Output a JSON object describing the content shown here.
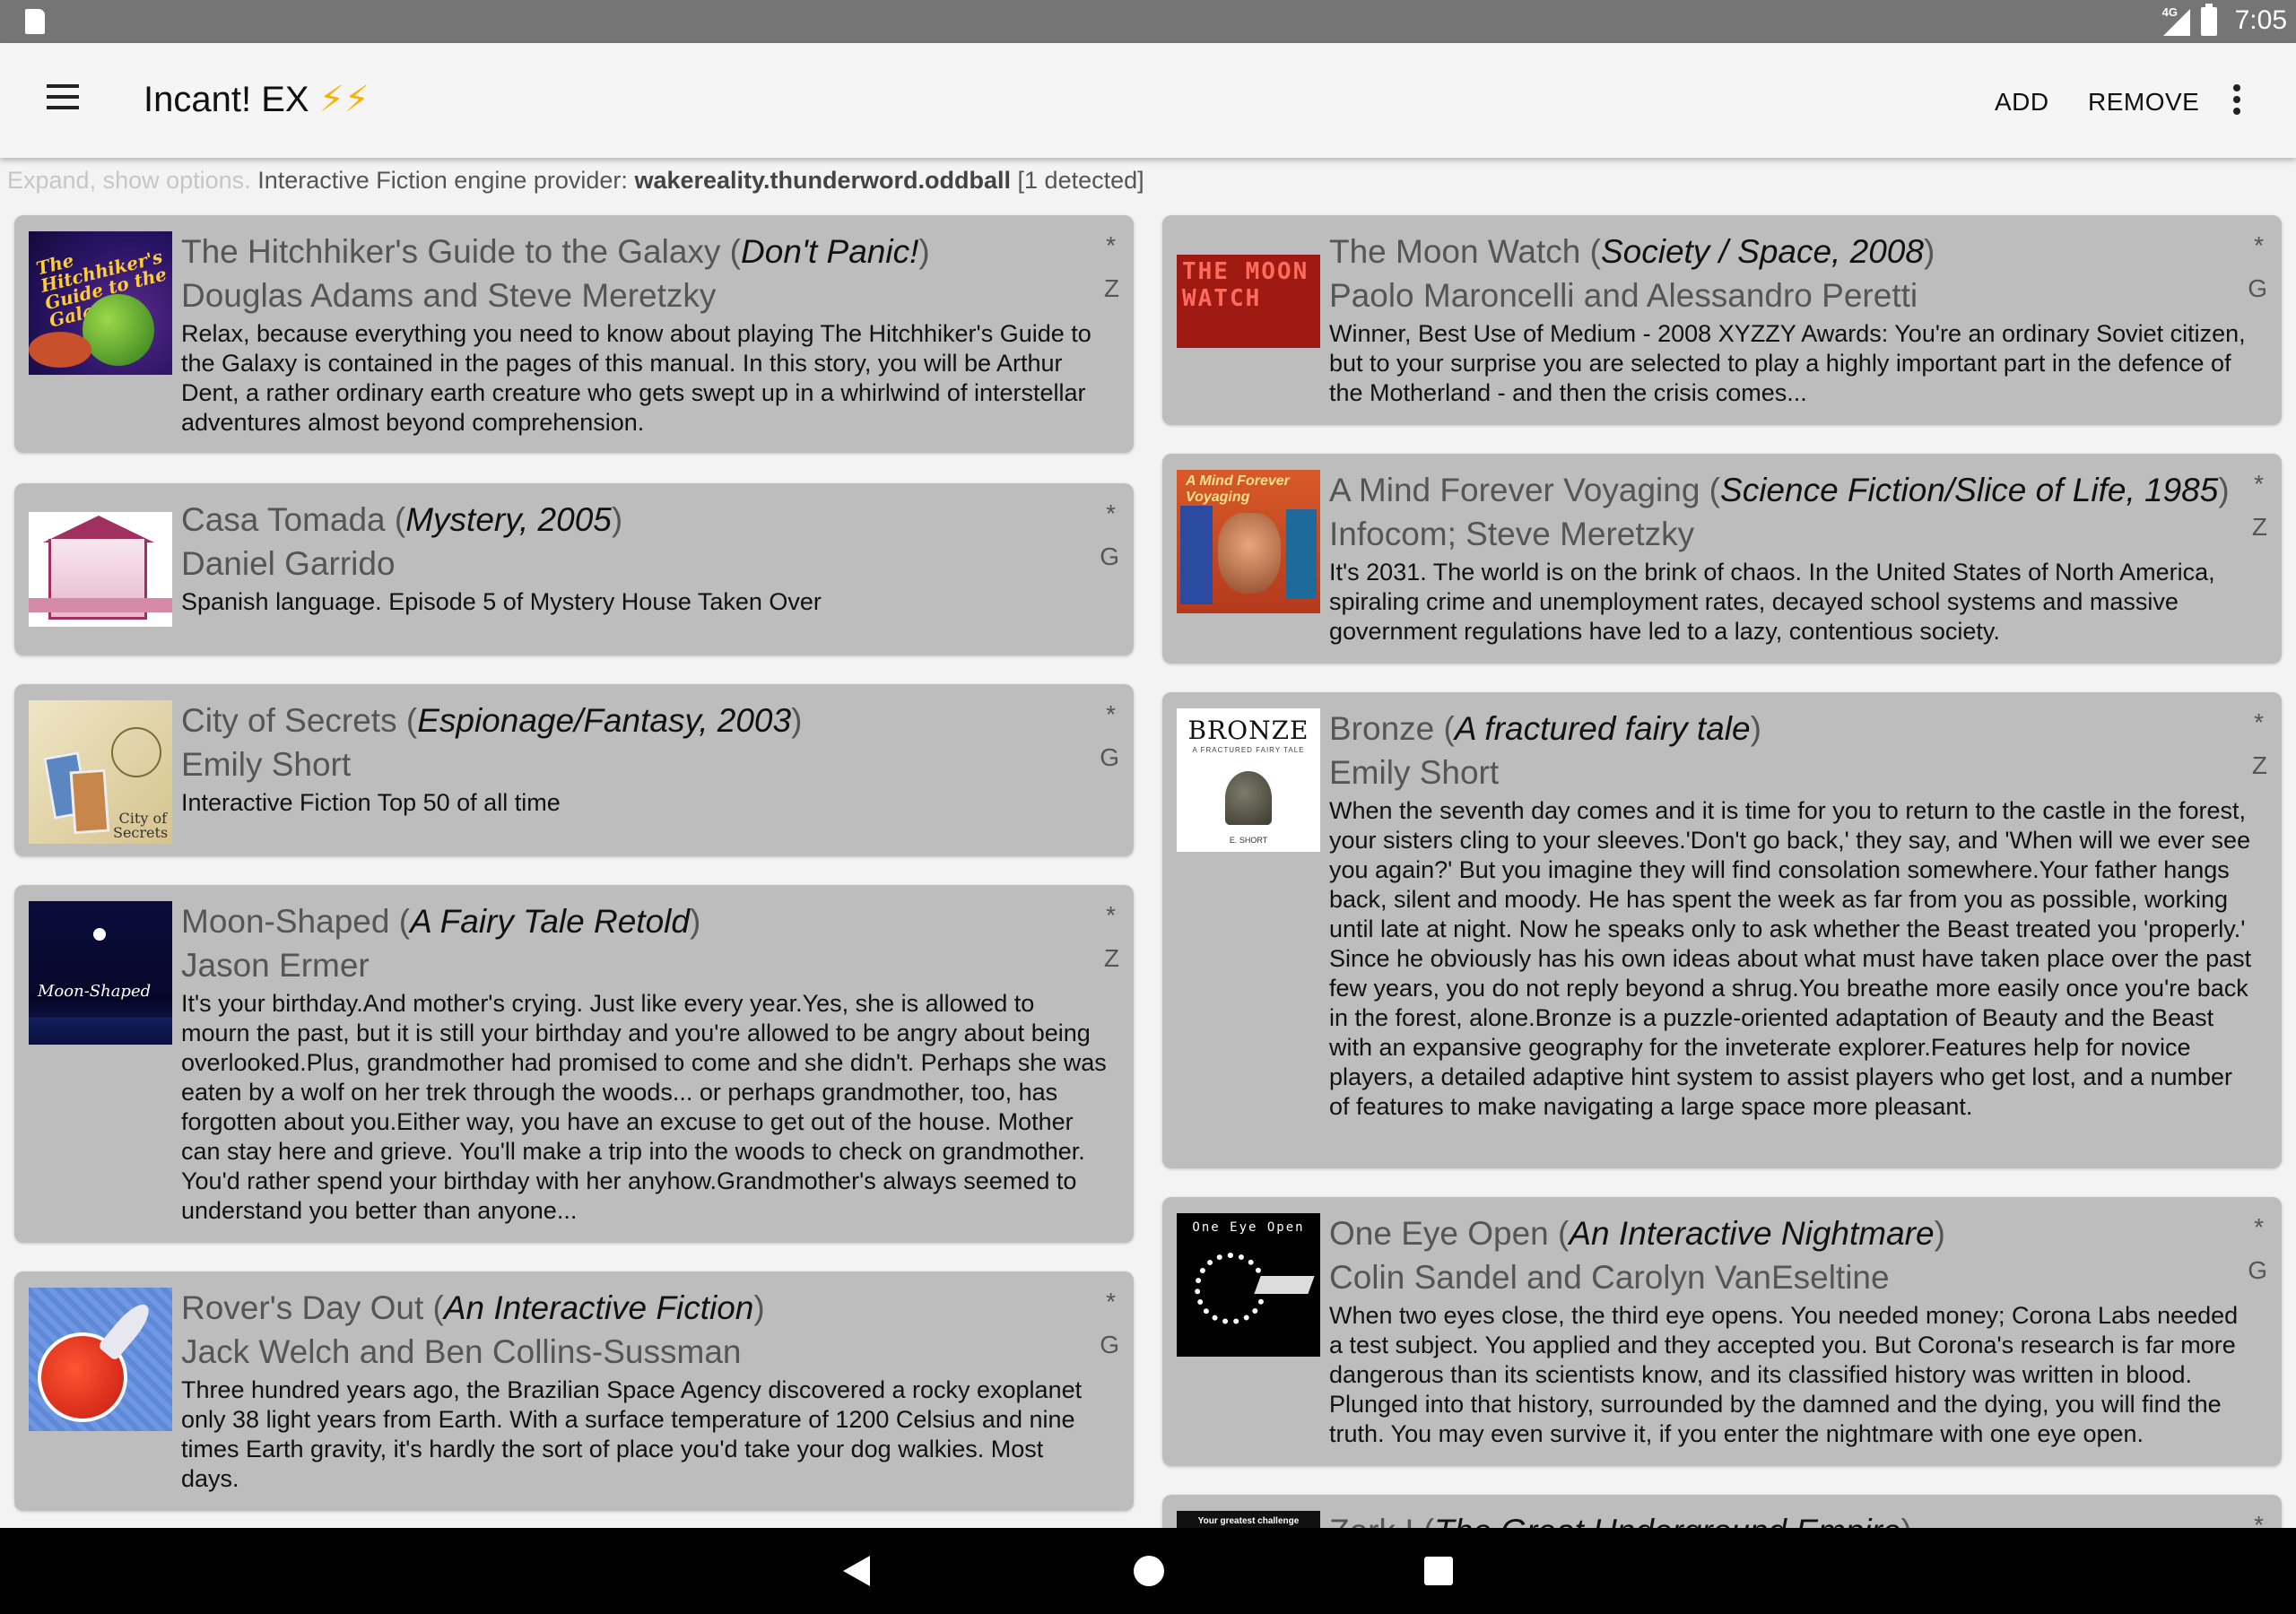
{
  "status_bar": {
    "time": "7:05",
    "network": "4G"
  },
  "app_bar": {
    "title": "Incant! EX",
    "title_icons": "⚡⚡",
    "add_label": "ADD",
    "remove_label": "REMOVE"
  },
  "provider": {
    "expand_label": "Expand, show options.",
    "prefix": "Interactive Fiction engine provider:",
    "name": "wakereality.thunderword.oddball",
    "count": "[1 detected]"
  },
  "stories_left": [
    {
      "title": "The Hitchhiker's Guide to the Galaxy",
      "genre": "Don't Panic!",
      "author": "Douglas Adams and Steve Meretzky",
      "description": "Relax, because everything you need to know about playing The Hitchhiker's Guide to the Galaxy is contained in the pages of this manual. In this story, you will be Arthur Dent, a rather ordinary earth creature who gets swept up in a whirlwind of interstellar adventures almost beyond comprehension.",
      "star": "*",
      "engine": "Z",
      "cover_text": "The Hitchhiker's Guide to the Galaxy"
    },
    {
      "title": "Casa Tomada",
      "genre": "Mystery, 2005",
      "author": "Daniel Garrido",
      "description": "Spanish language. Episode 5 of Mystery House Taken Over",
      "star": "*",
      "engine": "G"
    },
    {
      "title": "City of Secrets",
      "genre": "Espionage/Fantasy, 2003",
      "author": "Emily Short",
      "description": "Interactive Fiction Top 50 of all time",
      "star": "*",
      "engine": "G",
      "cover_text": "City of Secrets"
    },
    {
      "title": "Moon-Shaped",
      "genre": "A Fairy Tale Retold",
      "author": "Jason Ermer",
      "description": "It's your birthday.And mother's crying. Just like every year.Yes, she is allowed to mourn the past, but it is still your birthday and you're allowed to be angry about being overlooked.Plus, grandmother had promised to come and she didn't. Perhaps she was eaten by a wolf on her trek through the woods... or perhaps grandmother, too, has forgotten about you.Either way, you have an excuse to get out of the house. Mother can stay here and grieve. You'll make a trip into the woods to check on grandmother. You'd rather spend your birthday with her anyhow.Grandmother's always seemed to understand you better than anyone...",
      "star": "*",
      "engine": "Z",
      "cover_text": "Moon-Shaped"
    },
    {
      "title": "Rover's Day Out",
      "genre": "An Interactive Fiction",
      "author": "Jack Welch and Ben Collins-Sussman",
      "description": "Three hundred years ago, the Brazilian Space Agency discovered a rocky exoplanet only 38 light years from Earth. With a surface temperature of 1200 Celsius and nine times Earth gravity, it's hardly the sort of place you'd take your dog walkies. Most days.",
      "star": "*",
      "engine": "G"
    }
  ],
  "stories_right": [
    {
      "title": "The Moon Watch",
      "genre": "Society / Space, 2008",
      "author": "Paolo Maroncelli and Alessandro Peretti",
      "description": "Winner, Best Use of Medium - 2008 XYZZY Awards: You're an ordinary Soviet citizen, but to your surprise you are selected to play a highly important part in the defence of the Motherland - and then the crisis comes...",
      "star": "*",
      "engine": "G",
      "cover_text": "THE MOON WATCH"
    },
    {
      "title": "A Mind Forever Voyaging",
      "genre": "Science Fiction/Slice of Life, 1985",
      "author": "Infocom; Steve Meretzky",
      "description": "It's 2031. The world is on the brink of chaos. In the United States of North America, spiraling crime and unemployment rates, decayed school systems and massive government regulations have led to a lazy, contentious society.",
      "star": "*",
      "engine": "Z",
      "cover_text": "A Mind Forever Voyaging"
    },
    {
      "title": "Bronze",
      "genre": "A fractured fairy tale",
      "author": "Emily Short",
      "description": "When the seventh day comes and it is time for you to return to the castle in the forest, your sisters cling to your sleeves.'Don't go back,' they say, and 'When will we ever see you again?' But you imagine they will find consolation somewhere.Your father hangs back, silent and moody. He has spent the week as far from you as possible, working until late at night. Now he speaks only to ask whether the Beast treated you 'properly.' Since he obviously has his own ideas about what must have taken place over the past few years, you do not reply beyond a shrug.You breathe more easily once you're back in the forest, alone.Bronze is a puzzle-oriented adaptation of Beauty and the Beast with an expansive geography for the inveterate explorer.Features help for novice players, a detailed adaptive hint system to assist players who get lost, and a number of features to make navigating a large space more pleasant.",
      "star": "*",
      "engine": "Z",
      "cover_text": "BRONZE",
      "cover_subtext": "A FRACTURED FAIRY TALE",
      "cover_author": "E. SHORT"
    },
    {
      "title": "One Eye Open",
      "genre": "An Interactive Nightmare",
      "author": "Colin Sandel and Carolyn VanEseltine",
      "description": "When two eyes close, the third eye opens. You needed money; Corona Labs needed a test subject. You applied and they accepted you. But Corona's research is far more dangerous than its scientists know, and its classified history was written in blood. Plunged into that history, surrounded by the damned and the dying, you will find the truth. You may even survive it, if you enter the nightmare with one eye open.",
      "star": "*",
      "engine": "G",
      "cover_text": "One Eye Open"
    },
    {
      "title": "Zork I",
      "genre": "The Great Underground Empire",
      "author": "",
      "description": "",
      "star": "*",
      "engine": "",
      "cover_text": "Your greatest challenge"
    }
  ]
}
